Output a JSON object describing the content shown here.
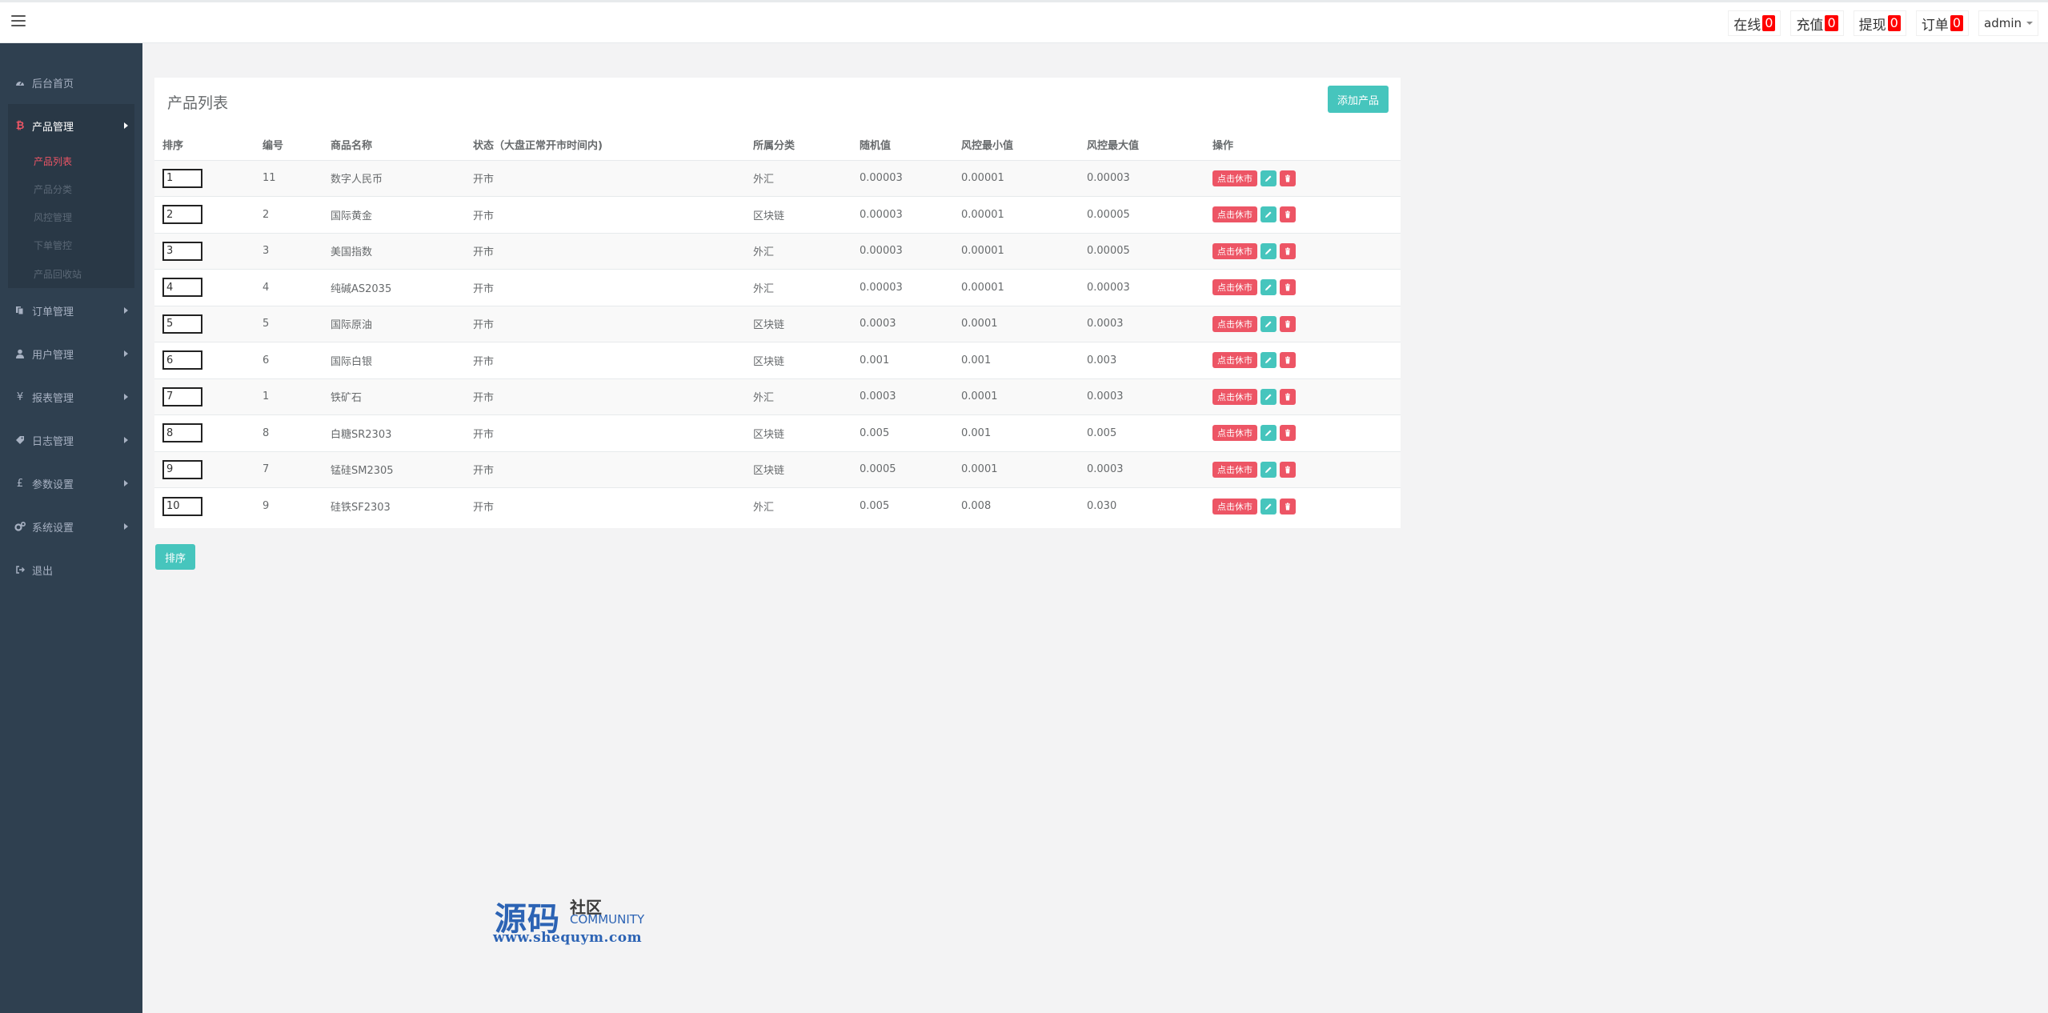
{
  "topbar": {
    "stats": [
      {
        "label": "在线",
        "count": "0"
      },
      {
        "label": "充值",
        "count": "0"
      },
      {
        "label": "提现",
        "count": "0"
      },
      {
        "label": "订单",
        "count": "0"
      }
    ],
    "user": "admin"
  },
  "sidebar": {
    "items": [
      {
        "label": "后台首页",
        "icon": "dashboard-icon"
      },
      {
        "label": "产品管理",
        "icon": "bitcoin-icon"
      },
      {
        "label": "订单管理",
        "icon": "files-icon"
      },
      {
        "label": "用户管理",
        "icon": "user-icon"
      },
      {
        "label": "报表管理",
        "icon": "yen-icon"
      },
      {
        "label": "日志管理",
        "icon": "tags-icon"
      },
      {
        "label": "参数设置",
        "icon": "pound-icon"
      },
      {
        "label": "系统设置",
        "icon": "gears-icon"
      },
      {
        "label": "退出",
        "icon": "sign-out-icon"
      }
    ],
    "product_sub": [
      "产品列表",
      "产品分类",
      "风控管理",
      "下单管控",
      "产品回收站"
    ]
  },
  "main": {
    "title": "产品列表",
    "add_button": "添加产品",
    "sort_button": "排序",
    "columns": [
      "排序",
      "编号",
      "商品名称",
      "状态（大盘正常开市时间内)",
      "所属分类",
      "随机值",
      "风控最小值",
      "风控最大值",
      "操作"
    ],
    "rows": [
      {
        "sort": "1",
        "id": "11",
        "name": "数字人民币",
        "status": "开市",
        "category": "外汇",
        "random": "0.00003",
        "min": "0.00001",
        "max": "0.00003"
      },
      {
        "sort": "2",
        "id": "2",
        "name": "国际黄金",
        "status": "开市",
        "category": "区块链",
        "random": "0.00003",
        "min": "0.00001",
        "max": "0.00005"
      },
      {
        "sort": "3",
        "id": "3",
        "name": "美国指数",
        "status": "开市",
        "category": "外汇",
        "random": "0.00003",
        "min": "0.00001",
        "max": "0.00005"
      },
      {
        "sort": "4",
        "id": "4",
        "name": "纯碱AS2035",
        "status": "开市",
        "category": "外汇",
        "random": "0.00003",
        "min": "0.00001",
        "max": "0.00003"
      },
      {
        "sort": "5",
        "id": "5",
        "name": "国际原油",
        "status": "开市",
        "category": "区块链",
        "random": "0.0003",
        "min": "0.0001",
        "max": "0.0003"
      },
      {
        "sort": "6",
        "id": "6",
        "name": "国际白银",
        "status": "开市",
        "category": "区块链",
        "random": "0.001",
        "min": "0.001",
        "max": "0.003"
      },
      {
        "sort": "7",
        "id": "1",
        "name": "铁矿石",
        "status": "开市",
        "category": "外汇",
        "random": "0.0003",
        "min": "0.0001",
        "max": "0.0003"
      },
      {
        "sort": "8",
        "id": "8",
        "name": "白糖SR2303",
        "status": "开市",
        "category": "区块链",
        "random": "0.005",
        "min": "0.001",
        "max": "0.005"
      },
      {
        "sort": "9",
        "id": "7",
        "name": "锰硅SM2305",
        "status": "开市",
        "category": "区块链",
        "random": "0.0005",
        "min": "0.0001",
        "max": "0.0003"
      },
      {
        "sort": "10",
        "id": "9",
        "name": "硅铁SF2303",
        "status": "开市",
        "category": "外汇",
        "random": "0.005",
        "min": "0.008",
        "max": "0.030"
      }
    ],
    "rest_button": "点击休市"
  },
  "watermark": {
    "big": "源码",
    "small": "社区",
    "community": "COMMUNITY",
    "url": "www.shequym.com"
  },
  "colors": {
    "sidebar_bg": "#2f4050",
    "accent": "#46c5bd",
    "danger": "#ed5565",
    "badge": "#ff0000"
  }
}
